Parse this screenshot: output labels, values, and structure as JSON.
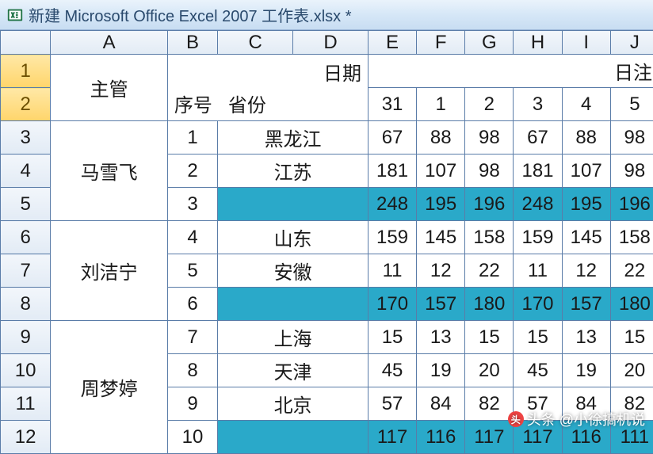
{
  "titlebar": {
    "text": "新建 Microsoft Office Excel 2007 工作表.xlsx *"
  },
  "columns": [
    "A",
    "B",
    "C",
    "D",
    "E",
    "F",
    "G",
    "H",
    "I",
    "J"
  ],
  "rows": [
    "1",
    "2",
    "3",
    "4",
    "5",
    "6",
    "7",
    "8",
    "9",
    "10",
    "11",
    "12"
  ],
  "selection": {
    "top_right": "日期",
    "bottom_left_a": "序号",
    "bottom_left_b": "省份"
  },
  "header2": {
    "big_right": "日注",
    "days": [
      "31",
      "1",
      "2",
      "3",
      "4",
      "5"
    ]
  },
  "merged": {
    "a12": "主管",
    "a35": "马雪飞",
    "a68": "刘洁宁",
    "a912": "周梦婷"
  },
  "r3": {
    "b": "1",
    "cd": "黑龙江",
    "e": "67",
    "f": "88",
    "g": "98",
    "h": "67",
    "i": "88",
    "j": "98"
  },
  "r4": {
    "b": "2",
    "cd": "江苏",
    "e": "181",
    "f": "107",
    "g": "98",
    "h": "181",
    "i": "107",
    "j": "98"
  },
  "r5": {
    "b": "3",
    "cd": "",
    "e": "248",
    "f": "195",
    "g": "196",
    "h": "248",
    "i": "195",
    "j": "196"
  },
  "r6": {
    "b": "4",
    "cd": "山东",
    "e": "159",
    "f": "145",
    "g": "158",
    "h": "159",
    "i": "145",
    "j": "158"
  },
  "r7": {
    "b": "5",
    "cd": "安徽",
    "e": "11",
    "f": "12",
    "g": "22",
    "h": "11",
    "i": "12",
    "j": "22"
  },
  "r8": {
    "b": "6",
    "cd": "",
    "e": "170",
    "f": "157",
    "g": "180",
    "h": "170",
    "i": "157",
    "j": "180"
  },
  "r9": {
    "b": "7",
    "cd": "上海",
    "e": "15",
    "f": "13",
    "g": "15",
    "h": "15",
    "i": "13",
    "j": "15"
  },
  "r10": {
    "b": "8",
    "cd": "天津",
    "e": "45",
    "f": "19",
    "g": "20",
    "h": "45",
    "i": "19",
    "j": "20"
  },
  "r11": {
    "b": "9",
    "cd": "北京",
    "e": "57",
    "f": "84",
    "g": "82",
    "h": "57",
    "i": "84",
    "j": "82"
  },
  "r12": {
    "b": "10",
    "cd": "",
    "e": "117",
    "f": "116",
    "g": "117",
    "h": "117",
    "i": "116",
    "j": "111"
  },
  "watermark": {
    "text": "头条 @小徐搞机说"
  }
}
